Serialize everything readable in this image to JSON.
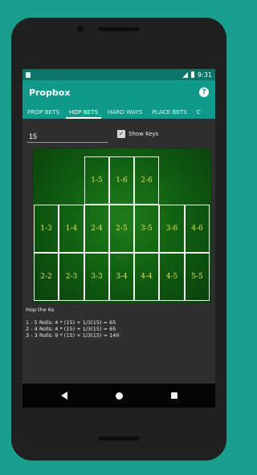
{
  "status": {
    "time": "9:31"
  },
  "appbar": {
    "title": "Propbox",
    "help_icon": "help-icon"
  },
  "tabs": [
    {
      "label": "PROP BETS",
      "active": false
    },
    {
      "label": "HOP BETS",
      "active": true
    },
    {
      "label": "HARD WAYS",
      "active": false
    },
    {
      "label": "PLACE BETS",
      "active": false
    },
    {
      "label": "C",
      "active": false
    }
  ],
  "controls": {
    "amount_value": "15",
    "show_keys_label": "Show Keys",
    "show_keys_checked": true
  },
  "board": {
    "top_row": [
      "1-5",
      "1-6",
      "2-6"
    ],
    "middle_row": [
      "1-3",
      "1-4",
      "2-4",
      "2-5",
      "3-5",
      "3-6",
      "4-6"
    ],
    "bottom_row": [
      "2-2",
      "2-3",
      "3-3",
      "3-4",
      "4-4",
      "4-5",
      "5-5"
    ]
  },
  "description": {
    "title": "Hop the 6s",
    "lines": [
      "1 - 5 Rolls: 4 * (15) + 1/3(15) = 65",
      "2 - 4 Rolls: 4 * (15) + 1/3(15) = 65",
      "3 - 3 Rolls: 9 * (15) + 1/3(15) = 140"
    ]
  },
  "navbar": {
    "icons": [
      "back-icon",
      "home-icon",
      "recents-icon"
    ]
  }
}
